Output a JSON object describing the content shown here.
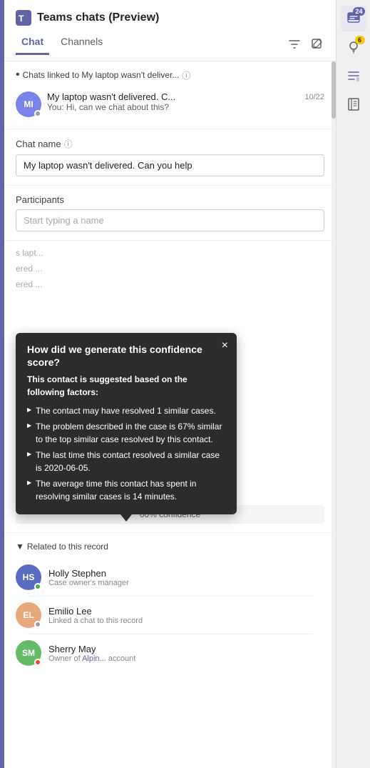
{
  "header": {
    "title": "Teams chats (Preview)",
    "tabs": [
      {
        "id": "chat",
        "label": "Chat",
        "active": true
      },
      {
        "id": "channels",
        "label": "Channels",
        "active": false
      }
    ]
  },
  "sidebar": {
    "icons": [
      {
        "id": "chat-icon",
        "badge": "24",
        "badgeColor": "purple"
      },
      {
        "id": "lightbulb-icon",
        "badge": "6",
        "badgeColor": "yellow"
      },
      {
        "id": "list-icon",
        "badge": null
      },
      {
        "id": "book-icon",
        "badge": null
      }
    ]
  },
  "chatsLinked": {
    "sectionLabel": "Chats linked to My laptop wasn't deliver...",
    "item": {
      "initials": "MI",
      "name": "My laptop wasn't delivered. C...",
      "time": "10/22",
      "preview": "You: Hi, can we chat about this?"
    }
  },
  "form": {
    "chatNameLabel": "Chat name",
    "chatNameInfo": "ℹ",
    "chatNameValue": "My laptop wasn't delivered. Can you help",
    "participantsLabel": "Participants",
    "participantsPlaceholder": "Start typing a name"
  },
  "tooltip": {
    "title": "How did we generate this confidence score?",
    "subtitle": "This contact is suggested based on the following factors:",
    "points": [
      "The contact may have resolved 1 similar cases.",
      "The problem described in the case is 67% similar to the top similar case resolved by this contact.",
      "The last time this contact resolved a similar case is 2020-06-05.",
      "The average time this contact has spent in resolving similar cases is 14 minutes."
    ],
    "closeLabel": "×"
  },
  "partialItems": [
    {
      "text": "s lapt..."
    },
    {
      "text": "ered ..."
    },
    {
      "text": "ered ..."
    }
  ],
  "confidence": {
    "label": "60% confidence"
  },
  "relatedSection": {
    "header": "Related to this record",
    "persons": [
      {
        "initials": "HS",
        "name": "Holly Stephen",
        "role": "Case owner's manager",
        "statusColor": "green",
        "avatarColor": "#5c6bc0"
      },
      {
        "initials": "EL",
        "name": "Emilio Lee",
        "role": "Linked a chat to this record",
        "statusColor": "gray",
        "avatarColor": "#e8a87c"
      },
      {
        "initials": "SM",
        "name": "Sherry May",
        "role": "Owner of Alpin... account",
        "roleHighlight": "Alpin...",
        "statusColor": "red",
        "avatarColor": "#66bb6a"
      }
    ]
  }
}
